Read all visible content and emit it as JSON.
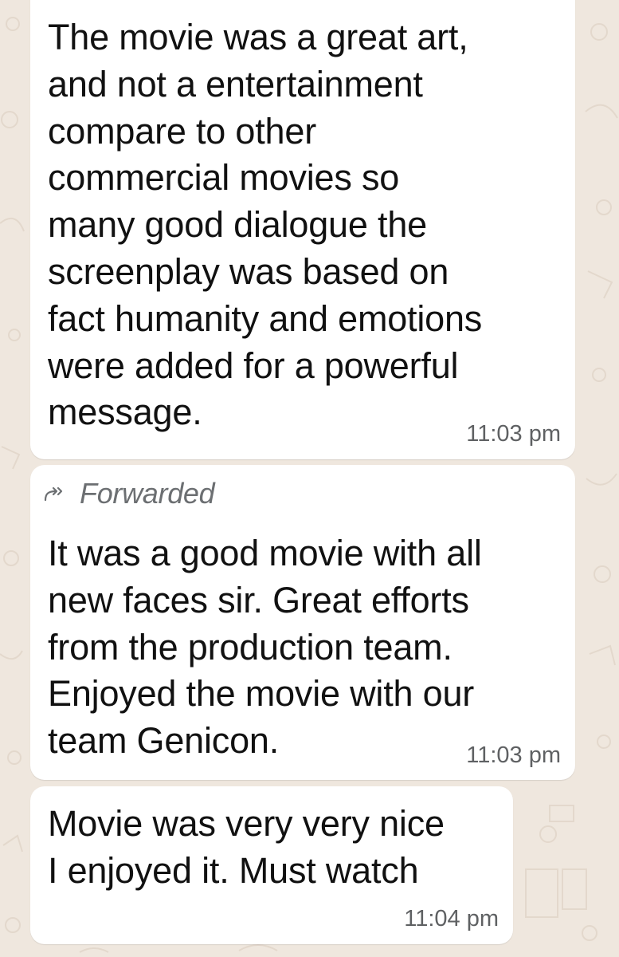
{
  "chat": {
    "messages": [
      {
        "text": "The movie was a great art,\nand not a entertainment\ncompare to other\ncommercial movies so\nmany good dialogue the\nscreenplay was based on\nfact humanity and emotions\nwere added for a powerful\nmessage.",
        "time": "11:03 pm"
      },
      {
        "forwarded_label": "Forwarded",
        "text": "It was a good movie with all\nnew faces sir. Great efforts\nfrom the production team.\nEnjoyed the movie with our\nteam Genicon.",
        "time": "11:03 pm"
      },
      {
        "text": "Movie was very very nice\nI enjoyed it. Must watch",
        "time": "11:04 pm"
      }
    ]
  },
  "icons": {
    "forwarded": "forward-arrow-icon"
  },
  "colors": {
    "background": "#efe7de",
    "bubble": "#ffffff",
    "text": "#111111",
    "timestamp": "#5f6163",
    "forwarded": "#6c6f72"
  }
}
